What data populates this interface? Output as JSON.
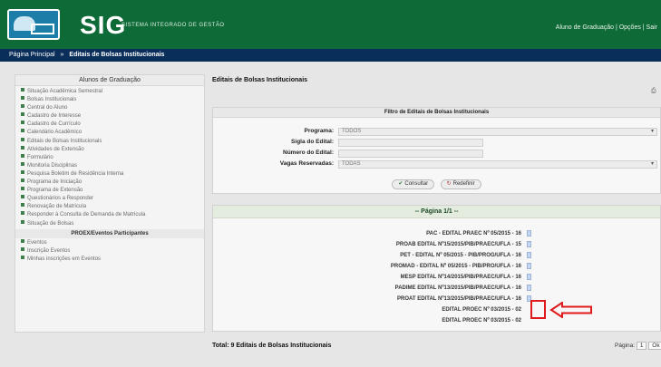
{
  "header": {
    "logo": "UFRA",
    "app_name": "SIG",
    "app_subtitle": "Sistema Integrado de Gestão",
    "user_links": "Aluno de Graduação | Opções | Sair"
  },
  "breadcrumb": {
    "home": "Página Principal",
    "separator": "»",
    "current": "Editais de Bolsas Institucionais"
  },
  "menu": {
    "title": "Alunos de Graduação",
    "items": [
      "Situação Acadêmica Semestral",
      "Bolsas Institucionais",
      "Central do Aluno",
      "Cadastro de Interesse",
      "Cadastro de Currículo",
      "Calendário Acadêmico",
      "Editais de Bolsas Institucionais",
      "Atividades de Extensão",
      "Formulário",
      "Monitoria Disciplinas",
      "Pesquisa Boletim de Residência Interna",
      "Programa de Iniciação",
      "Programa de Extensão",
      "Questionários a Responder",
      "Renovação de Matrícula",
      "Responder à Consulta de Demanda de Matrícula",
      "Situação de Bolsas"
    ],
    "section2_title": "PROEX/Eventos Participantes",
    "section2_items": [
      "Eventos",
      "Inscrição Eventos",
      "Minhas inscrições em Eventos"
    ]
  },
  "main": {
    "title": "Editais de Bolsas Institucionais",
    "print_label": "Imprimir"
  },
  "filter": {
    "title": "Filtro de Editais de Bolsas Institucionais",
    "fields": [
      {
        "label": "Programa:",
        "value": "TODOS",
        "type": "select"
      },
      {
        "label": "Sigla do Edital:",
        "value": "",
        "type": "text"
      },
      {
        "label": "Número do Edital:",
        "value": "",
        "type": "text"
      },
      {
        "label": "Vagas Reservadas:",
        "value": "TODAS",
        "type": "select"
      }
    ],
    "search_button": "Consultar",
    "cancel_button": "Redefinir"
  },
  "results": {
    "page_header": "-- Página 1/1 --",
    "items": [
      "PAC - EDITAL PRAEC Nº 05/2015 - 16",
      "PROAB EDITAL Nº15/2015/PIB/PRAEC/UFLA - 15",
      "PET - EDITAL Nº 05/2015 - PIB/PROG/UFLA - 16",
      "PROMAD - EDITAL Nº 05/2015 - PIB/PRO/UFLA - 16",
      "MESP EDITAL Nº14/2015/PIB/PRAEC/UFLA - 16",
      "PADIME EDITAL Nº13/2015/PIB/PRAEC/UFLA - 16",
      "PROAT EDITAL Nº13/2015/PIB/PRAEC/UFLA - 16",
      "EDITAL PROEC Nº 03/2015 - 02",
      "EDITAL PROEC Nº 03/2015 - 02"
    ],
    "total_label": "Total: 9 Editais de Bolsas Institucionais",
    "pager_label": "Página:",
    "pager_value": "1",
    "pager_go": "Ok"
  }
}
